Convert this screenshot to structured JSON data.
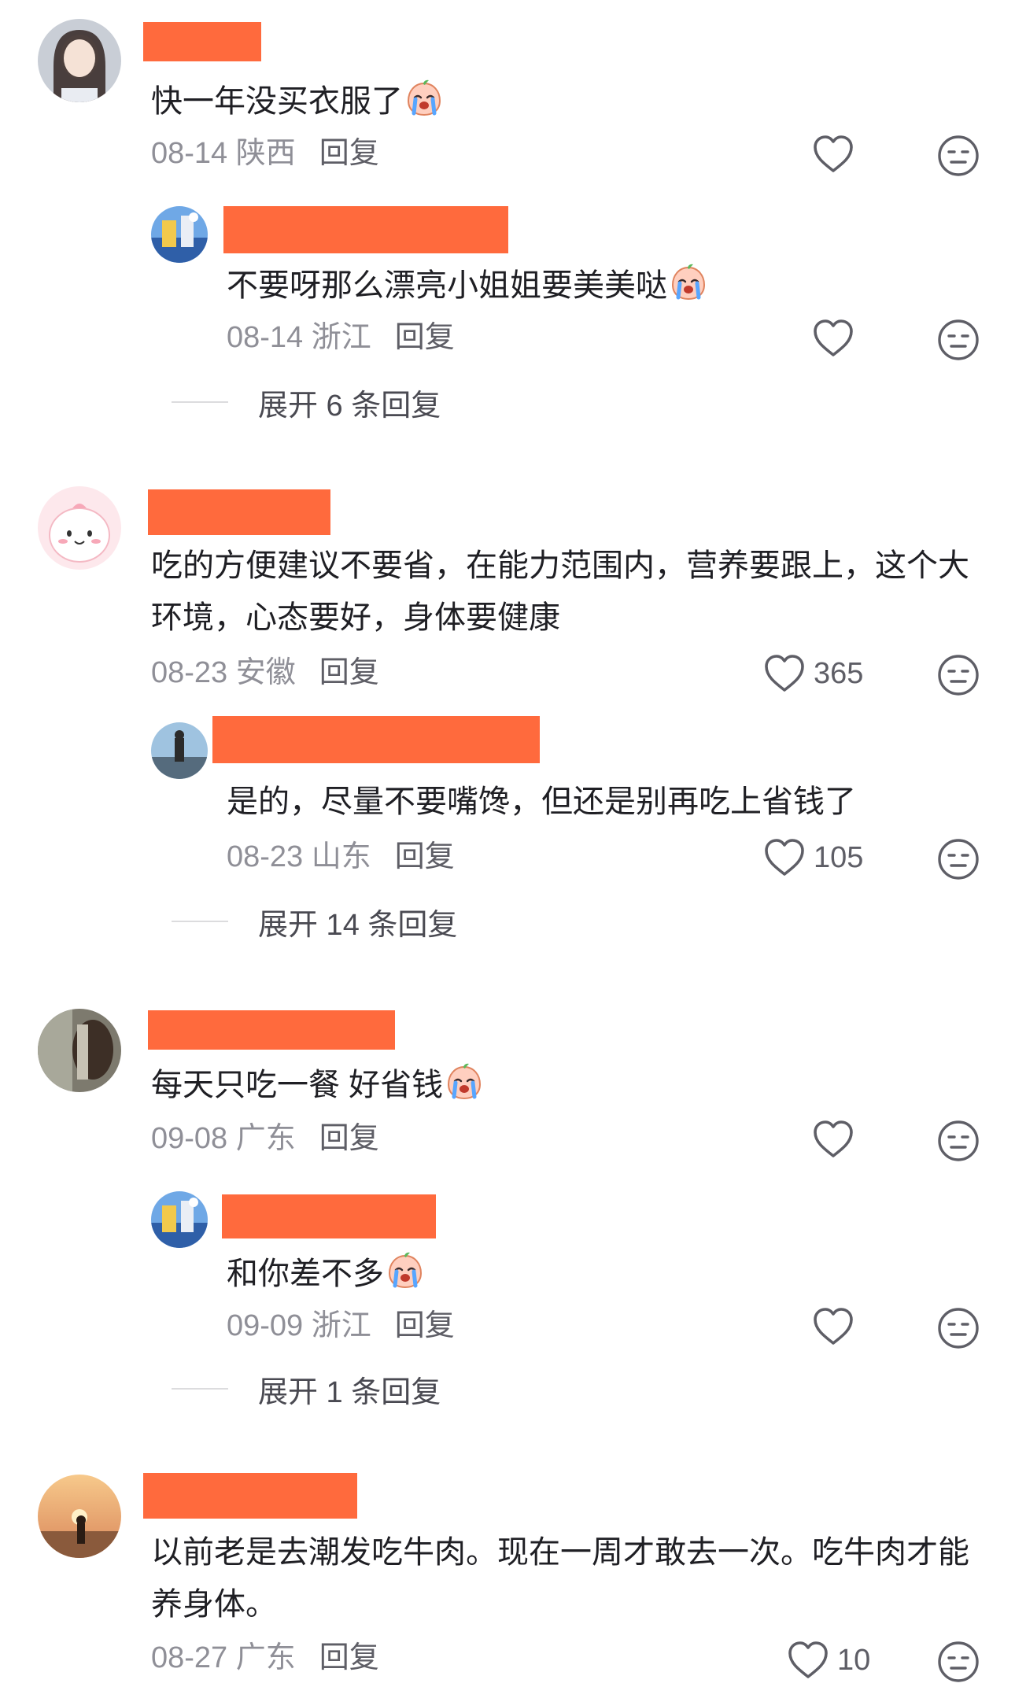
{
  "comments": [
    {
      "text": "快一年没买衣服了",
      "date": "08-14",
      "location": "陕西",
      "reply_label": "回复",
      "likes": "",
      "reply": {
        "text": "不要呀那么漂亮小姐姐要美美哒",
        "date": "08-14",
        "location": "浙江",
        "reply_label": "回复",
        "likes": ""
      },
      "expand_label": "展开 6 条回复"
    },
    {
      "text": "吃的方便建议不要省，在能力范围内，营养要跟上，这个大环境，心态要好，身体要健康",
      "date": "08-23",
      "location": "安徽",
      "reply_label": "回复",
      "likes": "365",
      "reply": {
        "text": "是的，尽量不要嘴馋，但还是别再吃上省钱了",
        "date": "08-23",
        "location": "山东",
        "reply_label": "回复",
        "likes": "105"
      },
      "expand_label": "展开 14 条回复"
    },
    {
      "text": "每天只吃一餐 好省钱",
      "date": "09-08",
      "location": "广东",
      "reply_label": "回复",
      "likes": "",
      "reply": {
        "text": "和你差不多",
        "date": "09-09",
        "location": "浙江",
        "reply_label": "回复",
        "likes": ""
      },
      "expand_label": "展开 1 条回复"
    },
    {
      "text": "以前老是去潮发吃牛肉。现在一周才敢去一次。吃牛肉才能养身体。",
      "date": "08-27",
      "location": "广东",
      "reply_label": "回复",
      "likes": "10"
    }
  ],
  "icons": {
    "like": "heart-outline-icon",
    "dislike": "neutral-face-icon",
    "emoji": "crying-emoji"
  },
  "colors": {
    "redaction": "#ff6a3d",
    "meta_text": "#8f8f97",
    "body_text": "#1f1f24"
  }
}
